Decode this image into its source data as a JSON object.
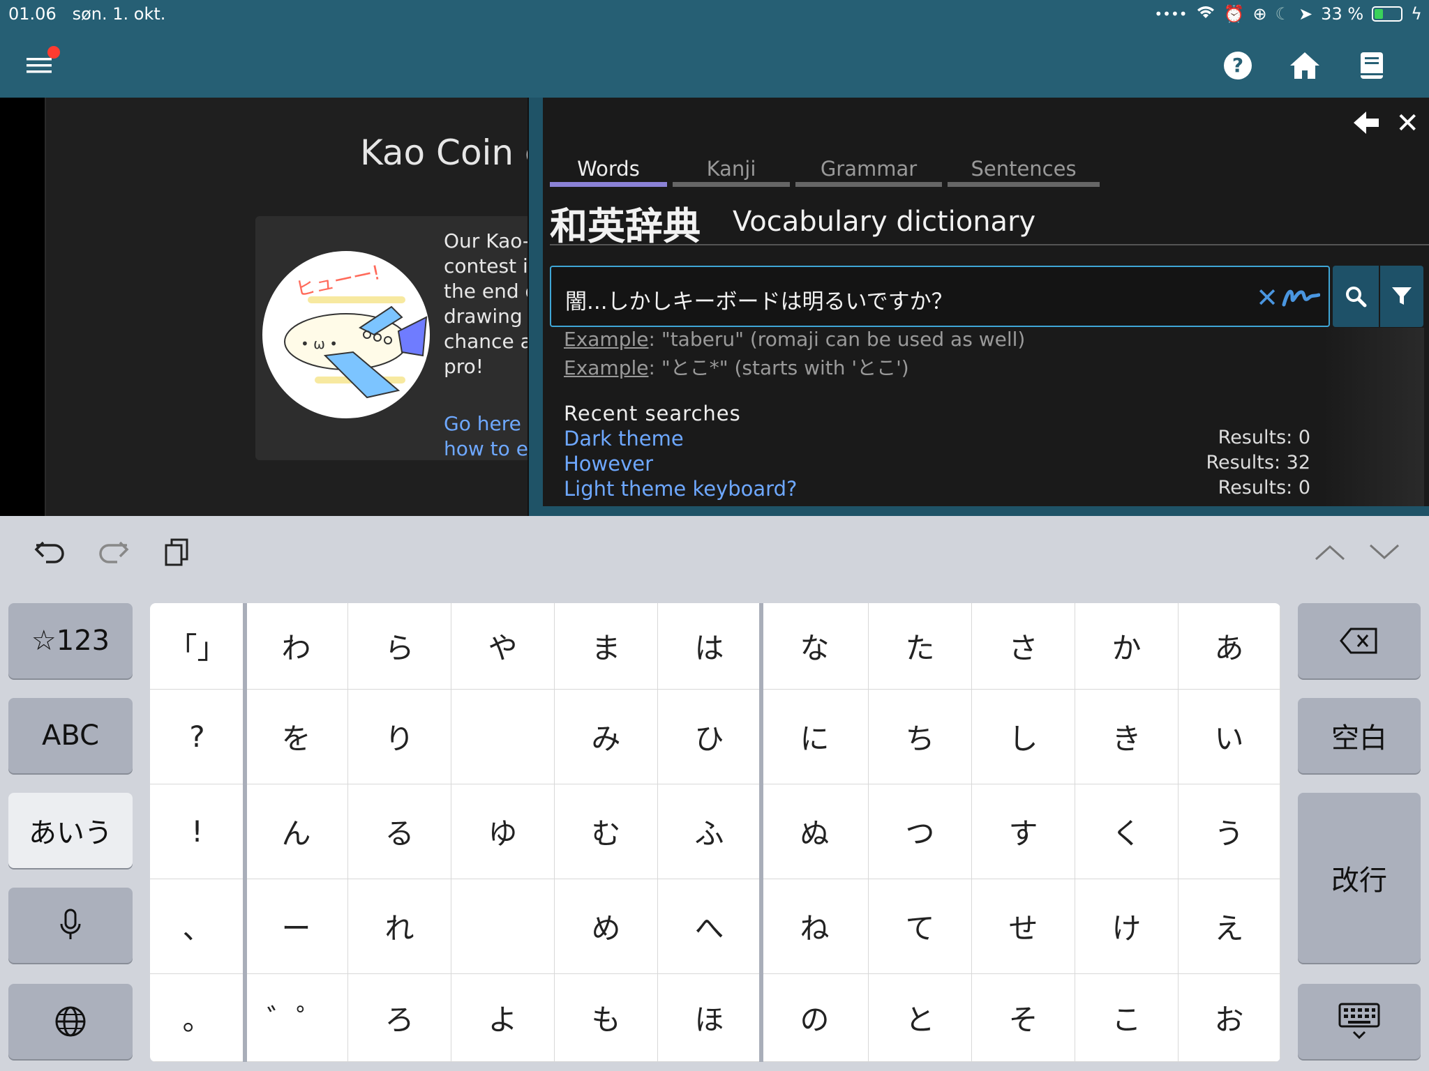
{
  "status_bar": {
    "time": "01.06",
    "date": "søn. 1. okt.",
    "battery": "33 %",
    "battery_level": 0.33
  },
  "header": {
    "menu_icon": "hamburger-menu-icon",
    "help_icon": "help-icon",
    "home_icon": "home-icon",
    "book_icon": "book-icon",
    "notification_color": "#ff3b30",
    "bg_color": "#265f74"
  },
  "background_page": {
    "title": "Kao Coin c",
    "card_text": "Our Kao-c\ncontest is\nthe end o\ndrawing a\nchance at\npro!",
    "card_link": "Go here f\nhow to er",
    "image_label": "ヒューー!"
  },
  "dictionary": {
    "tabs": [
      {
        "label": "Words",
        "active": true
      },
      {
        "label": "Kanji",
        "active": false
      },
      {
        "label": "Grammar",
        "active": false
      },
      {
        "label": "Sentences",
        "active": false
      }
    ],
    "heading_jp": "和英辞典",
    "heading_en": "Vocabulary dictionary",
    "search_value": "闇...しかしキーボードは明るいですか？",
    "examples": [
      {
        "prefix": "Example",
        "text": ": \"taberu\" (romaji can be used as well)"
      },
      {
        "prefix": "Example",
        "text": ": \"とこ*\" (starts with 'とこ')"
      }
    ],
    "recent_heading": "Recent searches",
    "recent": [
      {
        "query": "Dark theme",
        "count": "Results: 0"
      },
      {
        "query": "However",
        "count": "Results: 32"
      },
      {
        "query": "Light theme keyboard?",
        "count": "Results: 0"
      }
    ],
    "accent_color": "#3fa6d6",
    "link_color": "#6ea8ff"
  },
  "keyboard": {
    "left_keys": [
      "☆123",
      "ABC",
      "あいう",
      "mic",
      "globe"
    ],
    "right_keys": [
      "delete",
      "空白",
      "改行",
      "hide-keyboard"
    ],
    "grid": [
      [
        "「」",
        "わ",
        "ら",
        "や",
        "ま",
        "は",
        "な",
        "た",
        "さ",
        "か",
        "あ"
      ],
      [
        "?",
        "を",
        "り",
        "",
        "み",
        "ひ",
        "に",
        "ち",
        "し",
        "き",
        "い"
      ],
      [
        "!",
        "ん",
        "る",
        "ゆ",
        "む",
        "ふ",
        "ぬ",
        "つ",
        "す",
        "く",
        "う"
      ],
      [
        "、",
        "ー",
        "れ",
        "",
        "め",
        "へ",
        "ね",
        "て",
        "せ",
        "け",
        "え"
      ],
      [
        "。",
        "゛゜",
        "ろ",
        "よ",
        "も",
        "ほ",
        "の",
        "と",
        "そ",
        "こ",
        "お"
      ]
    ]
  }
}
